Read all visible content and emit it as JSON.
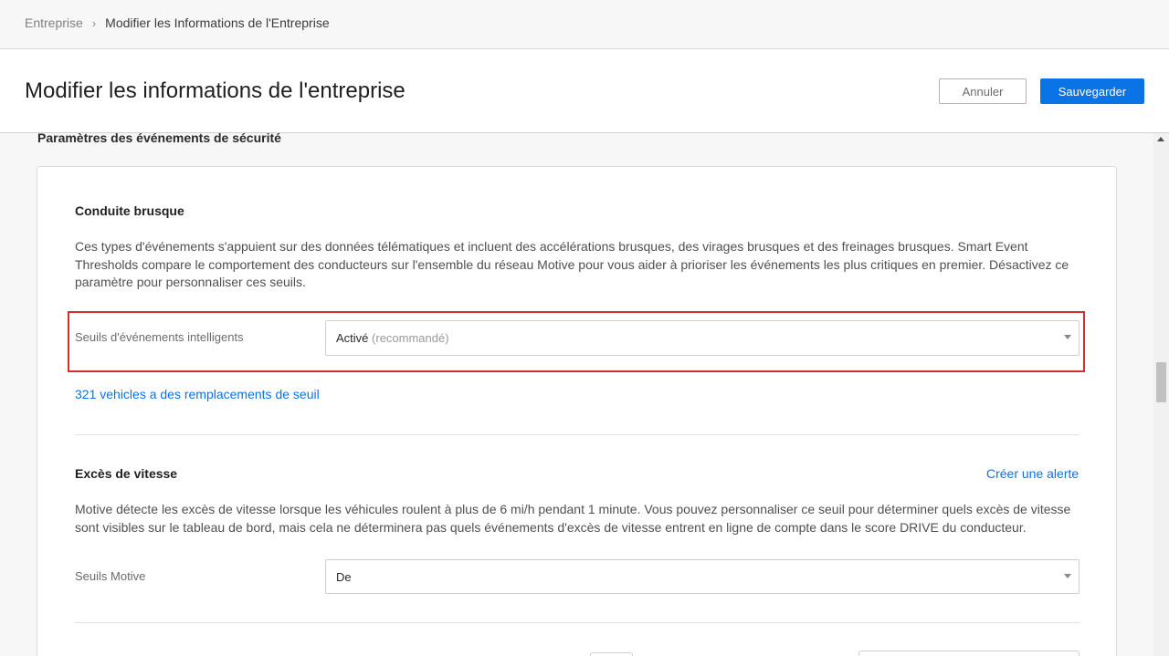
{
  "breadcrumb": {
    "parent": "Entreprise",
    "separator": "›",
    "current": "Modifier les Informations de l'Entreprise"
  },
  "header": {
    "title": "Modifier les informations de l'entreprise",
    "cancel_label": "Annuler",
    "save_label": "Sauvegarder"
  },
  "section": {
    "title": "Paramètres des événements de sécurité"
  },
  "harsh_driving": {
    "title": "Conduite brusque",
    "description": "Ces types d'événements s'appuient sur des données télématiques et incluent des accélérations brusques, des virages brusques et des freinages brusques. Smart Event Thresholds compare le comportement des conducteurs sur l'ensemble du réseau Motive pour vous aider à prioriser les événements les plus critiques en premier. Désactivez ce paramètre pour personnaliser ces seuils.",
    "field_label": "Seuils d'événements intelligents",
    "select_value": "Activé",
    "select_hint": "(recommandé)",
    "override_link": "321 vehicles a des remplacements de seuil"
  },
  "speeding": {
    "title": "Excès de vitesse",
    "create_alert": "Créer une alerte",
    "description": "Motive détecte les excès de vitesse lorsque les véhicules roulent à plus de 6 mi/h pendant 1 minute. Vous pouvez personnaliser ce seuil pour déterminer quels excès de vitesse sont visibles sur le tableau de bord, mais cela ne déterminera pas quels événements d'excès de vitesse entrent en ligne de compte dans le score DRIVE du conducteur.",
    "field_label": "Seuils Motive",
    "select_value": "De"
  },
  "colors": {
    "accent": "#0a73e6",
    "highlight": "#d32f2f"
  }
}
